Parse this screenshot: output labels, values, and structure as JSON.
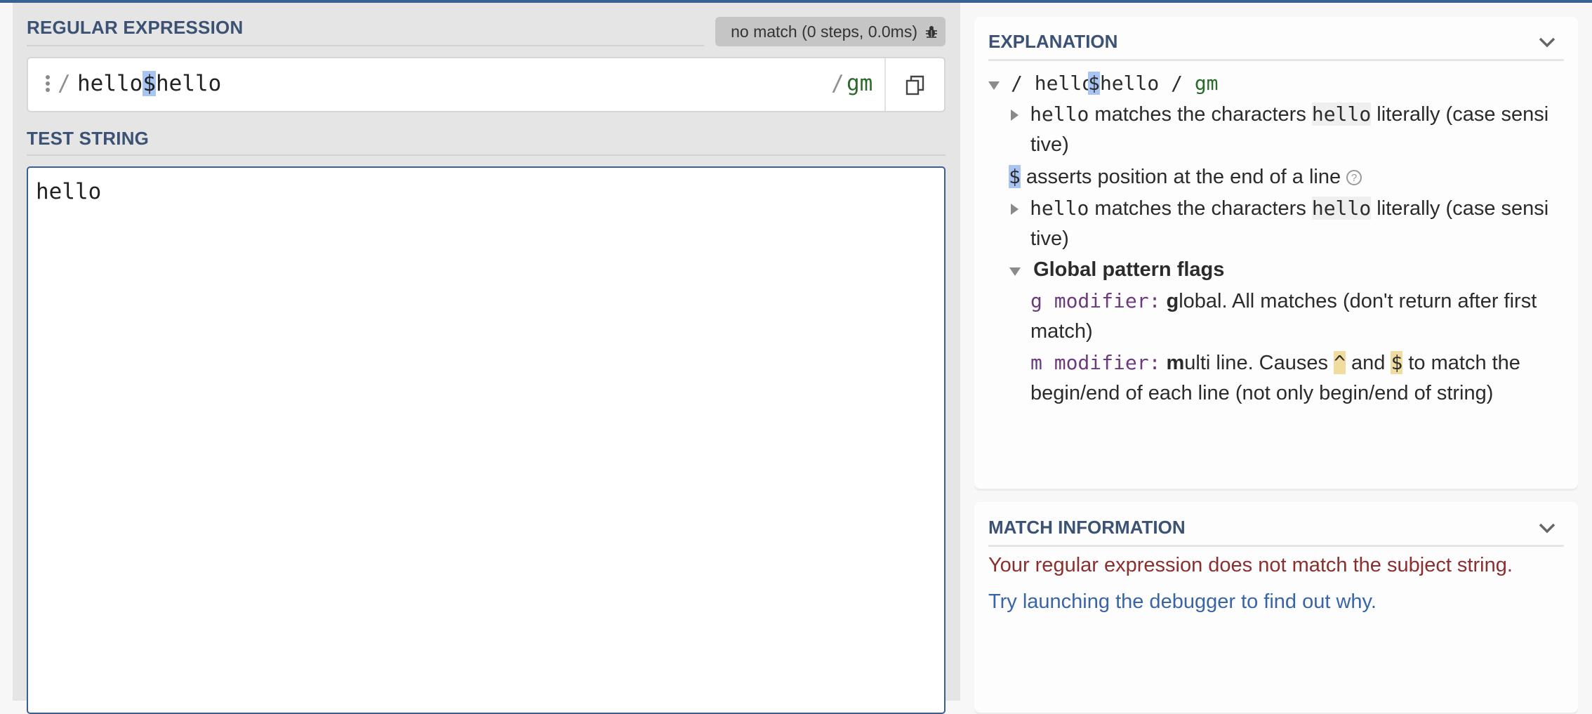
{
  "colors": {
    "accent": "#3a5f94",
    "flags": "#2a6a2a",
    "error": "#8b2e2e",
    "link": "#3a64a8",
    "modifier": "#6e3a7e"
  },
  "regex_section": {
    "title": "REGULAR EXPRESSION",
    "status_badge": "no match (0 steps, 0.0ms)",
    "status_icon": "bug-icon",
    "delimiter_open": "/",
    "pattern_before": "hello",
    "pattern_anchor": "$",
    "pattern_after": "hello",
    "delimiter_close": "/",
    "flags": "gm",
    "copy_icon": "copy-icon"
  },
  "test_section": {
    "title": "TEST STRING",
    "value": "hello"
  },
  "explanation": {
    "title": "EXPLANATION",
    "root": {
      "open": "/",
      "before": "hello",
      "anchor": "$",
      "after": "hello",
      "close": "/",
      "flags": "gm"
    },
    "items": [
      {
        "token": "hello",
        "text": " matches the characters ",
        "literal": "hello",
        "suffix": " literally (case sensi",
        "wrap": "tive)"
      },
      {
        "token": "$",
        "text": " asserts position at the end of a line"
      },
      {
        "token": "hello",
        "text": " matches the characters ",
        "literal": "hello",
        "suffix": " literally (case sensi",
        "wrap": "tive)"
      }
    ],
    "flags_group": {
      "title": "Global pattern flags",
      "g": {
        "label": "g modifier:",
        "bold": "g",
        "text": "lobal. All matches (don't return after first",
        "wrap": "match)"
      },
      "m": {
        "label": "m modifier:",
        "bold": "m",
        "text1": "ulti line. Causes ",
        "caret": "^",
        "and": " and ",
        "dollar": "$",
        "text2": " to match the",
        "wrap": "begin/end of each line (not only begin/end of string)"
      }
    }
  },
  "match_info": {
    "title": "MATCH INFORMATION",
    "error": "Your regular expression does not match the subject string.",
    "link": "Try launching the debugger to find out why."
  }
}
